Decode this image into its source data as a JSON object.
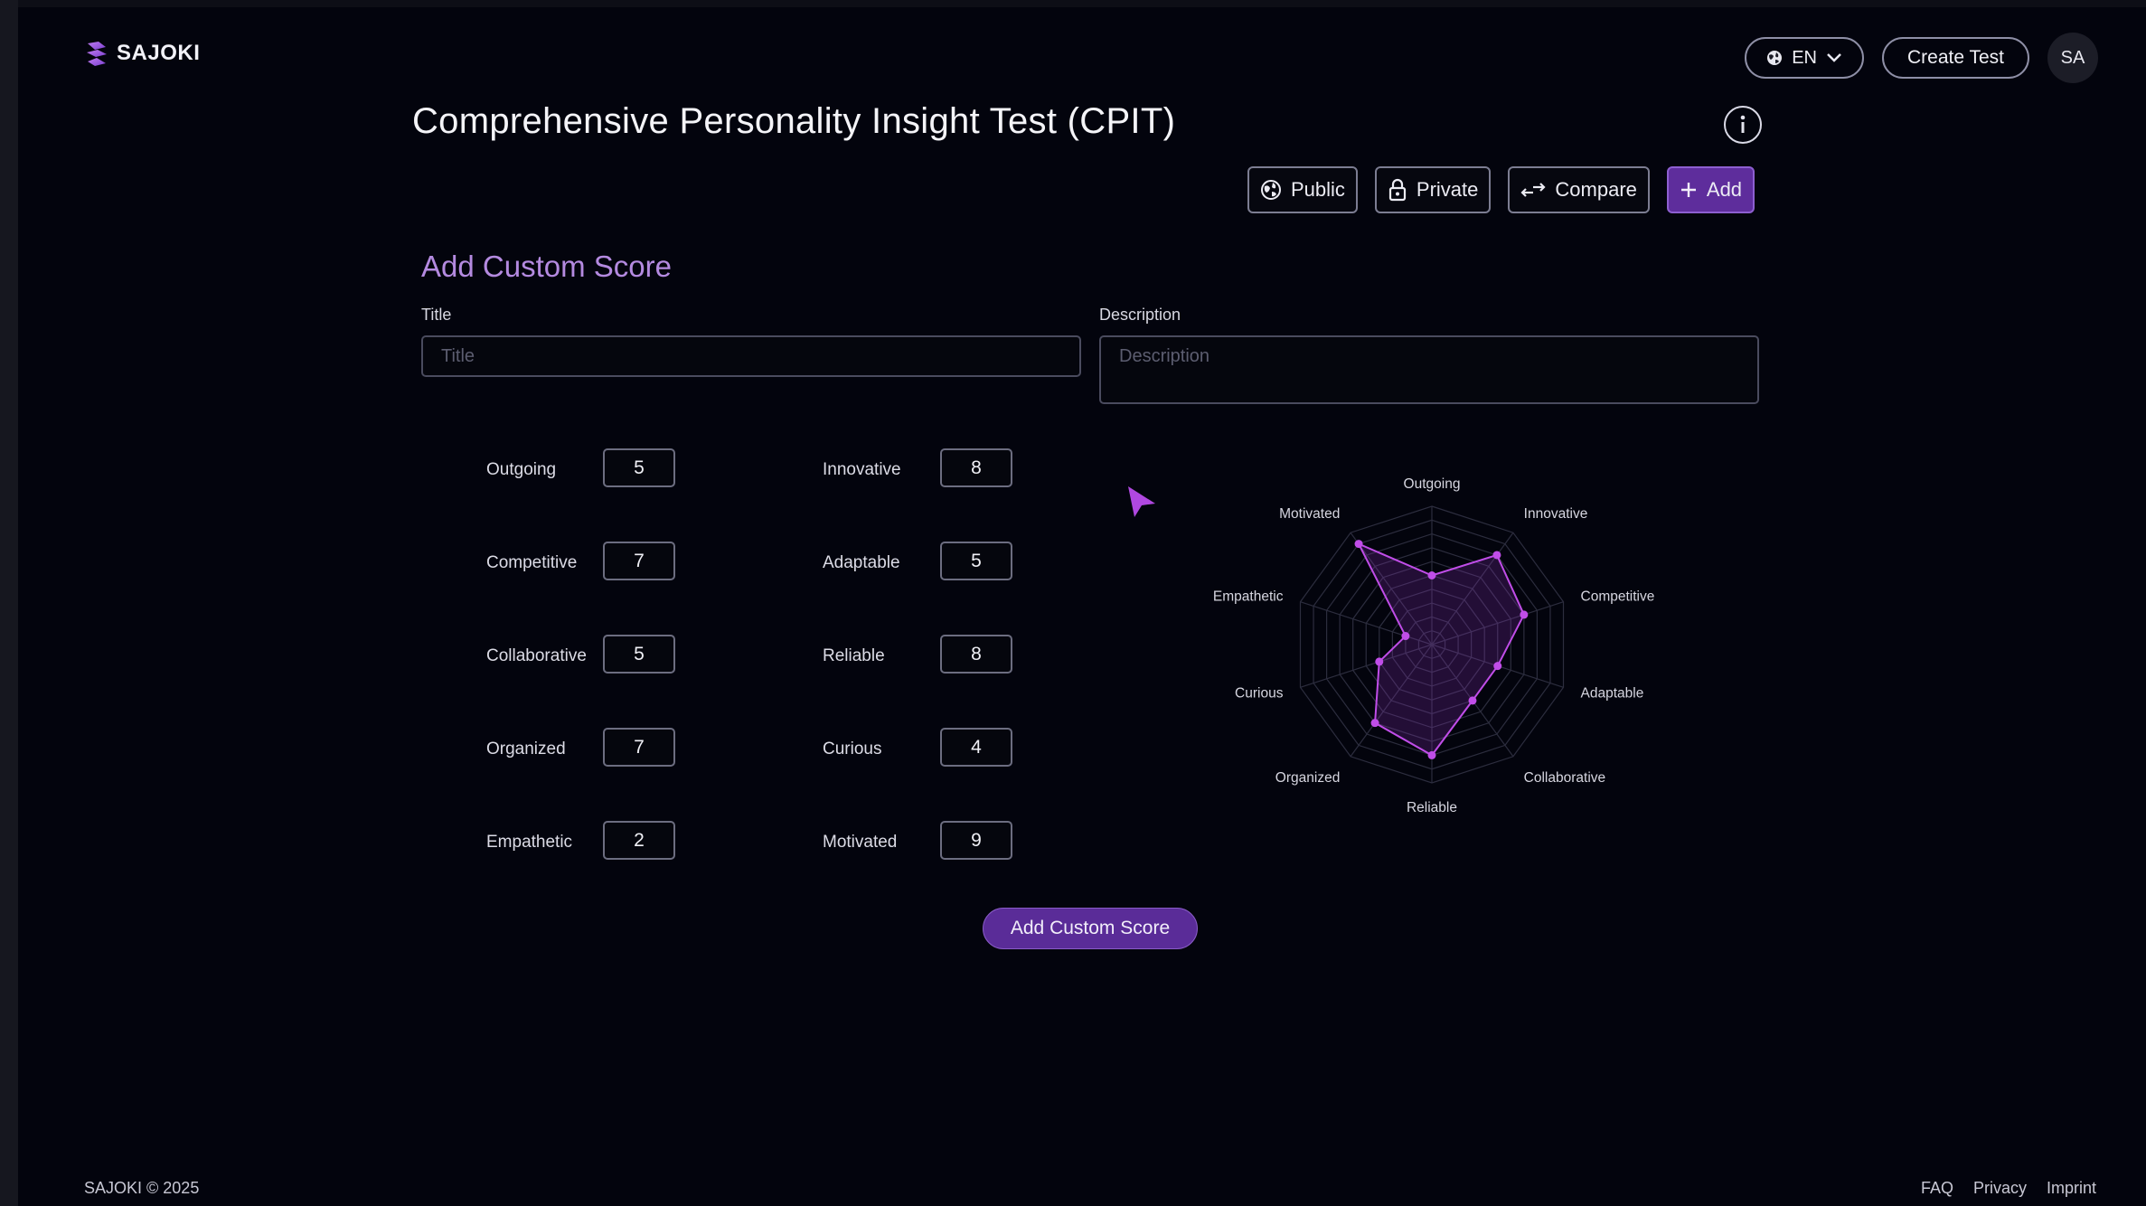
{
  "brand": {
    "name": "SAJOKI"
  },
  "header": {
    "language": "EN",
    "create_test_label": "Create Test",
    "avatar_initials": "SA"
  },
  "page": {
    "title": "Comprehensive Personality Insight Test (CPIT)",
    "actions": {
      "public": "Public",
      "private": "Private",
      "compare": "Compare",
      "add": "Add"
    }
  },
  "form": {
    "section_title": "Add Custom Score",
    "title_label": "Title",
    "title_placeholder": "Title",
    "title_value": "",
    "description_label": "Description",
    "description_placeholder": "Description",
    "description_value": "",
    "traits": [
      {
        "label": "Outgoing",
        "value": "5"
      },
      {
        "label": "Competitive",
        "value": "7"
      },
      {
        "label": "Collaborative",
        "value": "5"
      },
      {
        "label": "Organized",
        "value": "7"
      },
      {
        "label": "Empathetic",
        "value": "2"
      },
      {
        "label": "Innovative",
        "value": "8"
      },
      {
        "label": "Adaptable",
        "value": "5"
      },
      {
        "label": "Reliable",
        "value": "8"
      },
      {
        "label": "Curious",
        "value": "4"
      },
      {
        "label": "Motivated",
        "value": "9"
      }
    ],
    "submit_label": "Add Custom Score"
  },
  "chart_data": {
    "type": "radar",
    "axes": [
      "Outgoing",
      "Innovative",
      "Competitive",
      "Adaptable",
      "Collaborative",
      "Reliable",
      "Organized",
      "Curious",
      "Empathetic",
      "Motivated"
    ],
    "values": [
      5,
      8,
      7,
      5,
      5,
      8,
      7,
      4,
      2,
      9
    ],
    "range": [
      0,
      10
    ],
    "rings": 10,
    "grid": true,
    "series_color": "#c04de8"
  },
  "colors": {
    "accent": "#5e2d9c",
    "section_title": "#b48ae0",
    "background": "#03040d"
  },
  "footer": {
    "copyright": "SAJOKI © 2025",
    "links": [
      "FAQ",
      "Privacy",
      "Imprint"
    ]
  }
}
